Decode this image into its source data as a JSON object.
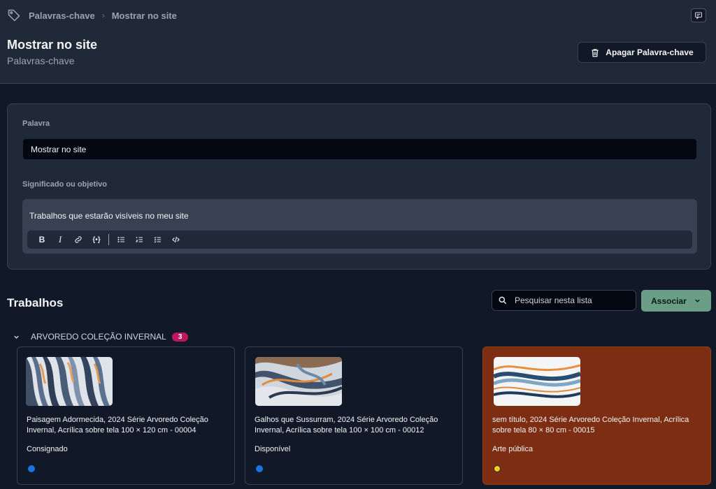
{
  "breadcrumb": {
    "root": "Palavras-chave",
    "current": "Mostrar no site"
  },
  "header": {
    "title": "Mostrar no site",
    "subtitle": "Palavras-chave",
    "delete_label": "Apagar Palavra-chave"
  },
  "form": {
    "word_label": "Palavra",
    "word_value": "Mostrar no site",
    "meaning_label": "Significado ou objetivo",
    "meaning_value": "Trabalhos que estarão visíveis no meu site",
    "toolbar": [
      "bold",
      "italic",
      "link",
      "variable",
      "bullet-list",
      "numbered-list",
      "check-list",
      "code"
    ]
  },
  "works": {
    "title": "Trabalhos",
    "search_placeholder": "Pesquisar nesta lista",
    "associate_label": "Associar",
    "group": {
      "name": "ARVOREDO COLEÇÃO INVERNAL",
      "count": "3"
    },
    "cards": [
      {
        "title": "Paisagem Adormecida, 2024 Série Arvoredo Coleção Invernal, Acrílica sobre tela 100 × 120 cm - 00004",
        "status": "Consignado",
        "dot_color": "#1d74e0"
      },
      {
        "title": "Galhos que Sussurram, 2024 Série Arvoredo Coleção Invernal, Acrílica sobre tela 100 × 100 cm - 00012",
        "status": "Disponível",
        "dot_color": "#1d74e0"
      },
      {
        "title": "sem título, 2024 Série Arvoredo Coleção Invernal, Acrílica sobre tela 80 × 80 cm - 00015",
        "status": "Arte pública",
        "dot_color": "#facc15"
      }
    ]
  },
  "colors": {
    "accent": "#6b9e87",
    "badge": "#be185d",
    "highlight_card": "#7c2d12"
  }
}
